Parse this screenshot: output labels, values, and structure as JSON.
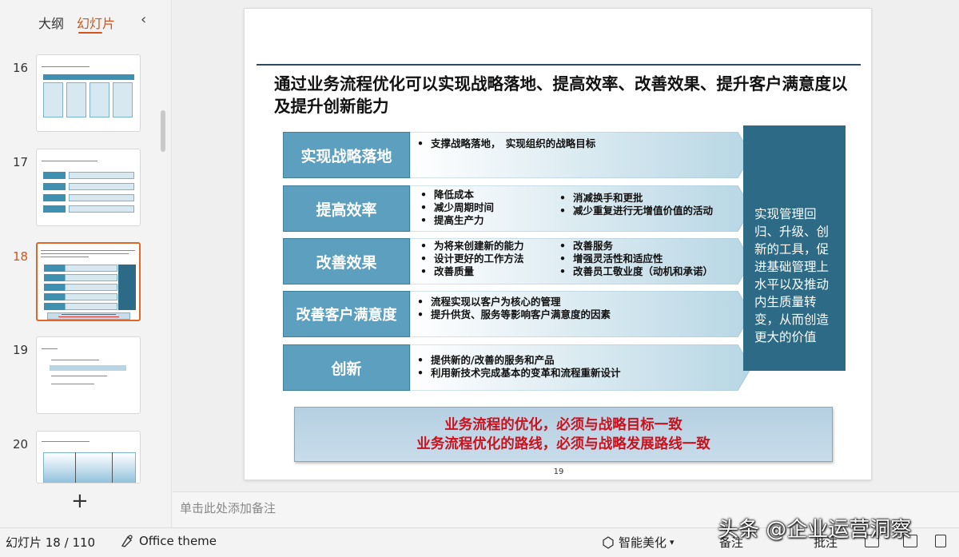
{
  "left_panel": {
    "tab_outline": "大纲",
    "tab_slides": "幻灯片",
    "collapse_icon": "‹",
    "add_slide_icon": "+",
    "thumbnails": [
      {
        "number": "16"
      },
      {
        "number": "17"
      },
      {
        "number": "18"
      },
      {
        "number": "19"
      },
      {
        "number": "20"
      }
    ]
  },
  "slide": {
    "title": "通过业务流程优化可以实现战略落地、提高效率、改善效果、提升客户满意度以及提升创新能力",
    "rows": [
      {
        "label": "实现战略落地",
        "bullets_left": [
          "支撑战略落地，　实现组织的战略目标"
        ],
        "bullets_right": []
      },
      {
        "label": "提高效率",
        "bullets_left": [
          "降低成本",
          "减少周期时间",
          "提高生产力"
        ],
        "bullets_right": [
          "消减换手和更批",
          "减少重复进行无增值价值的活动"
        ]
      },
      {
        "label": "改善效果",
        "bullets_left": [
          "为将来创建新的能力",
          "设计更好的工作方法",
          "改善质量"
        ],
        "bullets_right": [
          "改善服务",
          "增强灵活性和适应性",
          "改善员工敬业度（动机和承诺）"
        ]
      },
      {
        "label": "改善客户满意度",
        "bullets_left": [
          "流程实现以客户为核心的管理",
          "提升供货、服务等影响客户满意度的因素"
        ],
        "bullets_right": []
      },
      {
        "label": "创新",
        "bullets_left": [
          "提供新的/改善的服务和产品",
          "利用新技术完成基本的变革和流程重新设计"
        ],
        "bullets_right": []
      }
    ],
    "side_box": "实现管理回归、升级、创新的工具，促进基础管理上水平以及推动内生质量转变，从而创造更大的价值",
    "banner_line1": "业务流程的优化，必须与战略目标一致",
    "banner_line2": "业务流程优化的路线，必须与战略发展路线一致",
    "page_number": "19",
    "colors": {
      "label_bg": "#5d9fbe",
      "side_box_bg": "#2c6a86",
      "banner_text": "#c8121e",
      "active_accent": "#d4531c"
    }
  },
  "notes": {
    "placeholder": "单击此处添加备注"
  },
  "status_bar": {
    "slide_counter": "幻灯片 18 / 110",
    "theme_icon": "theme-icon",
    "theme_name": "Office theme",
    "beautify_label": "智能美化",
    "notes_label": "备注",
    "comments_label": "批注"
  },
  "watermark": "头条 @企业运营洞察"
}
